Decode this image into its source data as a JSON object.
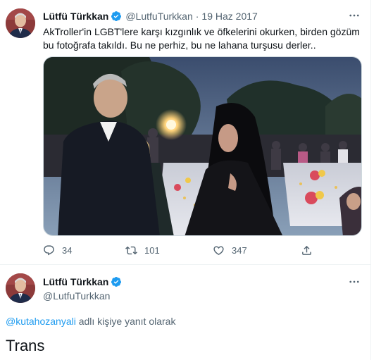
{
  "tweet": {
    "author_name": "Lütfü Türkkan",
    "author_handle": "@LutfuTurkkan",
    "separator": "·",
    "date": "19 Haz 2017",
    "text": "AkTroller'in LGBT'lere karşı kızgınlık ve öfkelerini okurken, birden gözüm bu fotoğrafa takıldı. Bu ne perhiz, bu ne lahana turşusu derler..",
    "stats": {
      "replies": "34",
      "retweets": "101",
      "likes": "347"
    }
  },
  "reply": {
    "author_name": "Lütfü Türkkan",
    "author_handle": "@LutfuTurkkan",
    "reply_to_handle": "@kutahozanyali",
    "reply_to_suffix": " adlı kişiye yanıt olarak",
    "text": "Trans"
  },
  "icons": {
    "verified": "verified-badge-icon",
    "more": "more-dots-icon",
    "reply": "reply-icon",
    "retweet": "retweet-icon",
    "like": "heart-icon",
    "share": "share-icon"
  },
  "colors": {
    "accent": "#1d9bf0",
    "secondary_text": "#536471",
    "border": "#eff3f4"
  }
}
